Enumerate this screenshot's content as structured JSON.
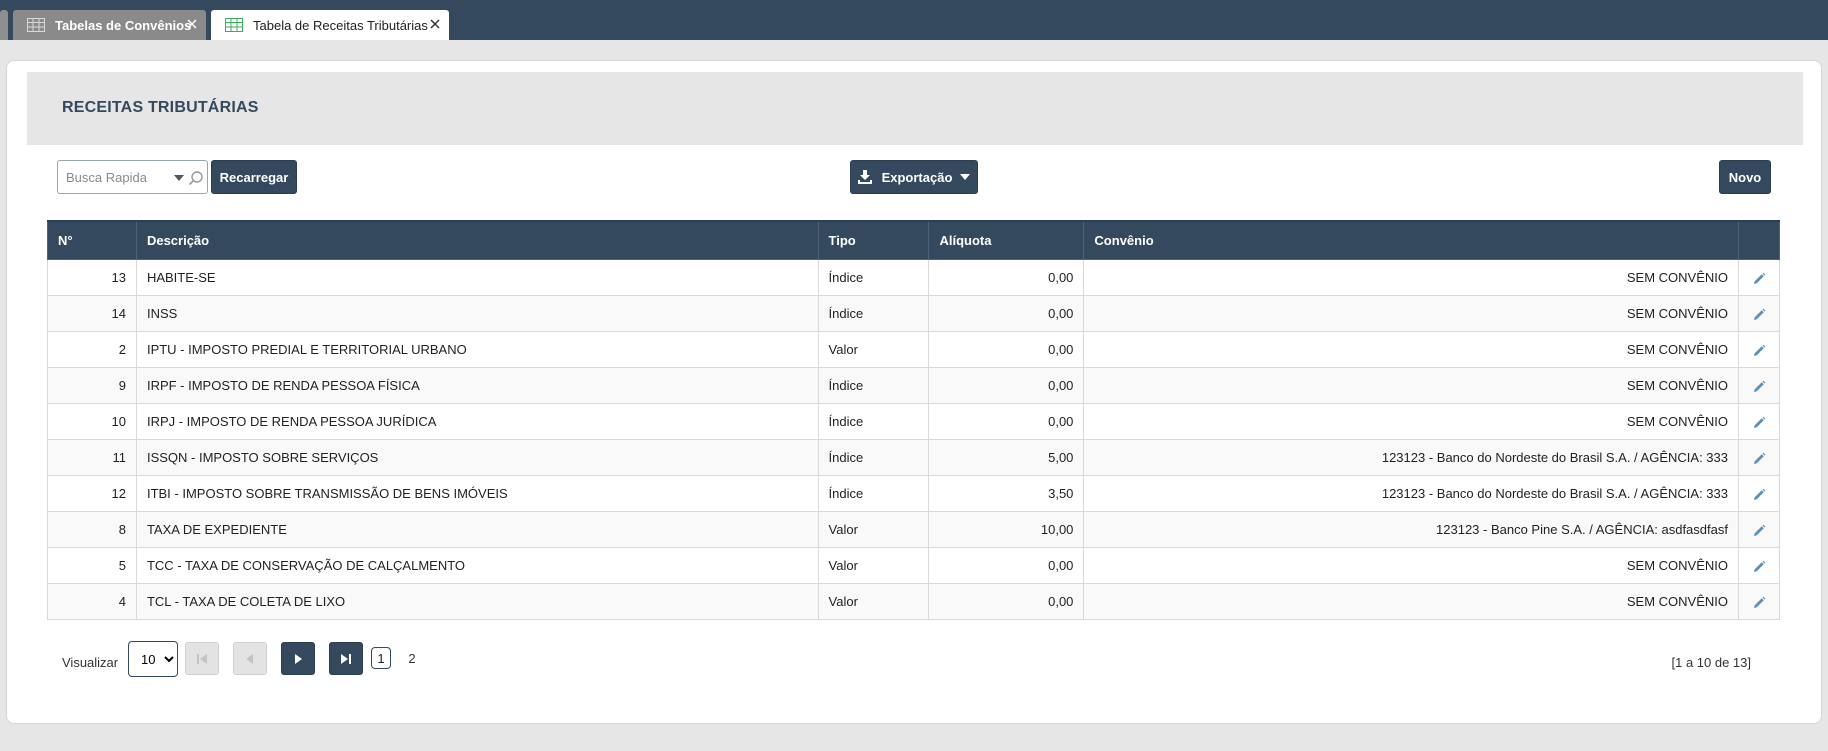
{
  "tabs": [
    {
      "label": "Tabelas de Convênios",
      "active": false
    },
    {
      "label": "Tabela de Receitas Tributárias",
      "active": true
    }
  ],
  "page": {
    "title": "RECEITAS TRIBUTÁRIAS"
  },
  "toolbar": {
    "search_placeholder": "Busca Rapida",
    "reload_label": "Recarregar",
    "export_label": "Exportação",
    "new_label": "Novo"
  },
  "table": {
    "columns": [
      "N°",
      "Descrição",
      "Tipo",
      "Alíquota",
      "Convênio"
    ],
    "rows": [
      {
        "num": "13",
        "desc": "HABITE-SE",
        "tipo": "Índice",
        "aliquota": "0,00",
        "convenio": "SEM CONVÊNIO"
      },
      {
        "num": "14",
        "desc": "INSS",
        "tipo": "Índice",
        "aliquota": "0,00",
        "convenio": "SEM CONVÊNIO"
      },
      {
        "num": "2",
        "desc": "IPTU - IMPOSTO PREDIAL E TERRITORIAL URBANO",
        "tipo": "Valor",
        "aliquota": "0,00",
        "convenio": "SEM CONVÊNIO"
      },
      {
        "num": "9",
        "desc": "IRPF - IMPOSTO DE RENDA PESSOA FÍSICA",
        "tipo": "Índice",
        "aliquota": "0,00",
        "convenio": "SEM CONVÊNIO"
      },
      {
        "num": "10",
        "desc": "IRPJ - IMPOSTO DE RENDA PESSOA JURÍDICA",
        "tipo": "Índice",
        "aliquota": "0,00",
        "convenio": "SEM CONVÊNIO"
      },
      {
        "num": "11",
        "desc": "ISSQN - IMPOSTO SOBRE SERVIÇOS",
        "tipo": "Índice",
        "aliquota": "5,00",
        "convenio": "123123 - Banco do Nordeste do Brasil S.A. / AGÊNCIA: 333"
      },
      {
        "num": "12",
        "desc": "ITBI - IMPOSTO SOBRE TRANSMISSÃO DE BENS IMÓVEIS",
        "tipo": "Índice",
        "aliquota": "3,50",
        "convenio": "123123 - Banco do Nordeste do Brasil S.A. / AGÊNCIA: 333"
      },
      {
        "num": "8",
        "desc": "TAXA DE EXPEDIENTE",
        "tipo": "Valor",
        "aliquota": "10,00",
        "convenio": "123123 - Banco Pine S.A. / AGÊNCIA: asdfasdfasf"
      },
      {
        "num": "5",
        "desc": "TCC - TAXA DE CONSERVAÇÃO DE CALÇALMENTO",
        "tipo": "Valor",
        "aliquota": "0,00",
        "convenio": "SEM CONVÊNIO"
      },
      {
        "num": "4",
        "desc": "TCL - TAXA DE COLETA DE LIXO",
        "tipo": "Valor",
        "aliquota": "0,00",
        "convenio": "SEM CONVÊNIO"
      }
    ]
  },
  "pagination": {
    "label": "Visualizar",
    "page_size": "10",
    "page_size_options": [
      "10"
    ],
    "pages": [
      "1",
      "2"
    ],
    "current_page": "1",
    "range_text": "[1 a 10 de 13]"
  },
  "icons": {
    "tab_grid": "table-grid-icon",
    "close": "close-icon",
    "search": "search-icon",
    "download": "download-icon",
    "edit": "pencil-icon",
    "first": "first-page-icon",
    "prev": "prev-page-icon",
    "next": "next-page-icon",
    "last": "last-page-icon"
  },
  "colors": {
    "primary": "#34495e",
    "tab_inactive": "#8a8a8a",
    "grid_icon_green": "#3cae5b",
    "edit_icon": "#5b8fb5"
  }
}
